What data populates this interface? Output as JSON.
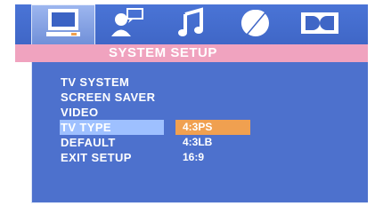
{
  "tabs": [
    {
      "name": "system-tab",
      "icon": "monitor-icon",
      "active": true
    },
    {
      "name": "language-tab",
      "icon": "person-speech-icon",
      "active": false
    },
    {
      "name": "audio-tab",
      "icon": "music-note-icon",
      "active": false
    },
    {
      "name": "video-tab",
      "icon": "contrast-circle-icon",
      "active": false
    },
    {
      "name": "dolby-tab",
      "icon": "dolby-icon",
      "active": false
    }
  ],
  "header": {
    "title": "SYSTEM SETUP"
  },
  "menu": {
    "items": [
      {
        "label": "TV SYSTEM"
      },
      {
        "label": "SCREEN SAVER"
      },
      {
        "label": "VIDEO"
      },
      {
        "label": "TV TYPE",
        "selected": true
      },
      {
        "label": "DEFAULT"
      },
      {
        "label": "EXIT SETUP"
      }
    ]
  },
  "submenu": {
    "items": [
      {
        "label": "4:3PS",
        "selected": true
      },
      {
        "label": "4:3LB"
      },
      {
        "label": "16:9"
      }
    ]
  },
  "colors": {
    "tabbar": "#4a74d6",
    "header": "#f0a3bf",
    "panel": "#4d71cd",
    "menu_highlight": "#9ec0ff",
    "submenu_highlight": "#f0a050"
  }
}
